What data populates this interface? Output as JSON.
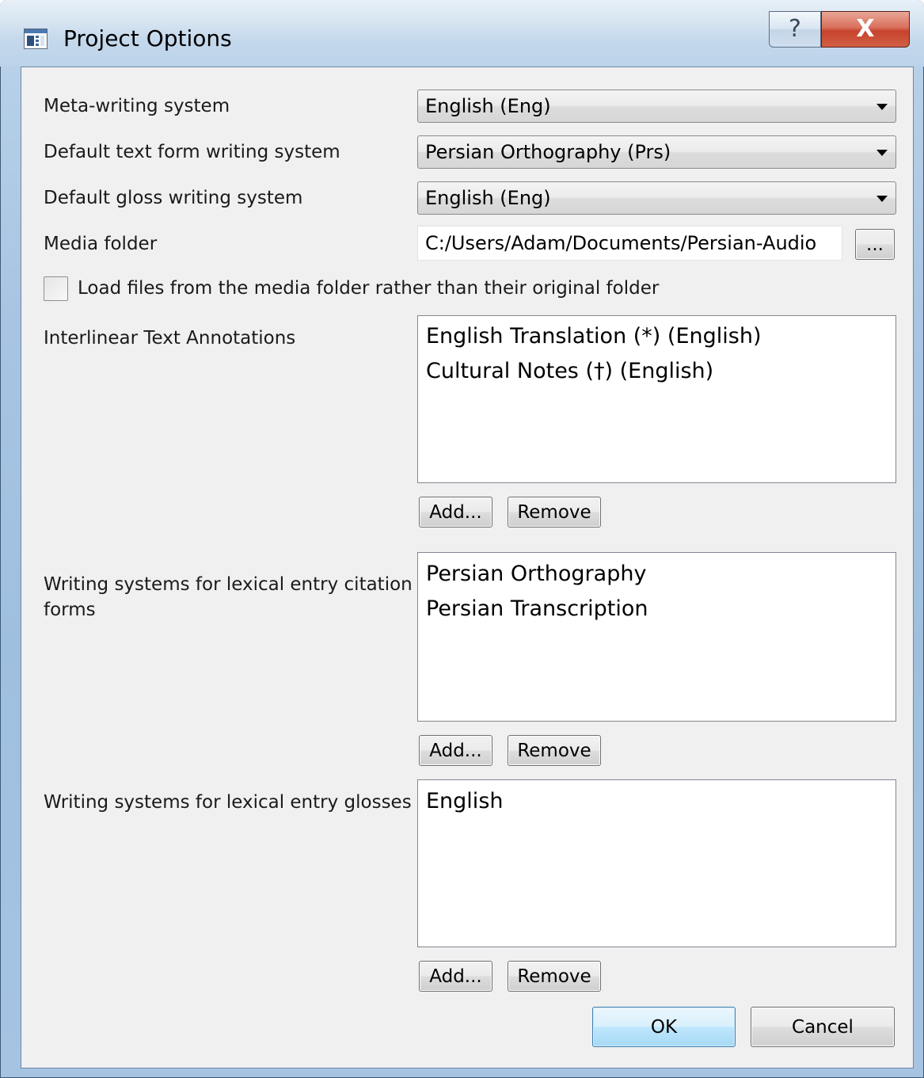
{
  "window": {
    "title": "Project Options",
    "help_glyph": "?",
    "close_glyph": "X",
    "icon": "application-window-icon"
  },
  "settings": {
    "meta_writing_system": {
      "label": "Meta-writing system",
      "value": "English (Eng)"
    },
    "default_text_form_ws": {
      "label": "Default text form writing system",
      "value": "Persian Orthography (Prs)"
    },
    "default_gloss_ws": {
      "label": "Default gloss writing system",
      "value": "English (Eng)"
    },
    "media_folder": {
      "label": "Media folder",
      "value": "C:/Users/Adam/Documents/Persian-Audio",
      "browse_label": "..."
    },
    "load_from_media": {
      "label": "Load files from the media folder rather than their original folder",
      "checked": false
    }
  },
  "interlinear": {
    "label": "Interlinear Text Annotations",
    "items": [
      "English Translation (*) (English)",
      "Cultural Notes (†) (English)"
    ],
    "add_label": "Add...",
    "remove_label": "Remove"
  },
  "citation_forms": {
    "label_line1": "Writing systems for lexical entry citation",
    "label_line2": "forms",
    "items": [
      "Persian Orthography",
      "Persian Transcription"
    ],
    "add_label": "Add...",
    "remove_label": "Remove"
  },
  "glosses": {
    "label": "Writing systems for lexical entry glosses",
    "items": [
      "English"
    ],
    "add_label": "Add...",
    "remove_label": "Remove"
  },
  "footer": {
    "ok_label": "OK",
    "cancel_label": "Cancel"
  }
}
